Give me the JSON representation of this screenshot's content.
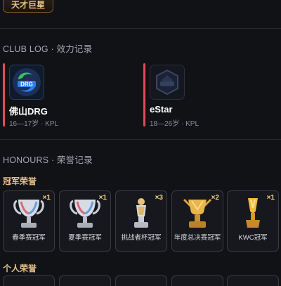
{
  "header": {
    "badge": "天才巨星"
  },
  "club_log": {
    "title": "CLUB LOG · 效力记录",
    "clubs": [
      {
        "name": "佛山DRG",
        "meta": "16—17岁 · KPL",
        "logo": "drg-logo",
        "color": "#2f7df0"
      },
      {
        "name": "eStar",
        "meta": "18—26岁 · KPL",
        "logo": "estar-logo",
        "color": "#26324a"
      }
    ]
  },
  "honours": {
    "title": "HONOURS · 荣誉记录",
    "champion_title": "冠军荣誉",
    "trophies": [
      {
        "label": "春季赛冠军",
        "count": "×1",
        "icon": "silver-cup-icon"
      },
      {
        "label": "夏季赛冠军",
        "count": "×1",
        "icon": "silver-cup-icon"
      },
      {
        "label": "挑战者杯冠军",
        "count": "×3",
        "icon": "challenger-cup-icon"
      },
      {
        "label": "年度总决赛冠军",
        "count": "×2",
        "icon": "gold-cup-icon"
      },
      {
        "label": "KWC冠军",
        "count": "×1",
        "icon": "kwc-cup-icon"
      }
    ],
    "personal_title": "个人荣誉"
  }
}
